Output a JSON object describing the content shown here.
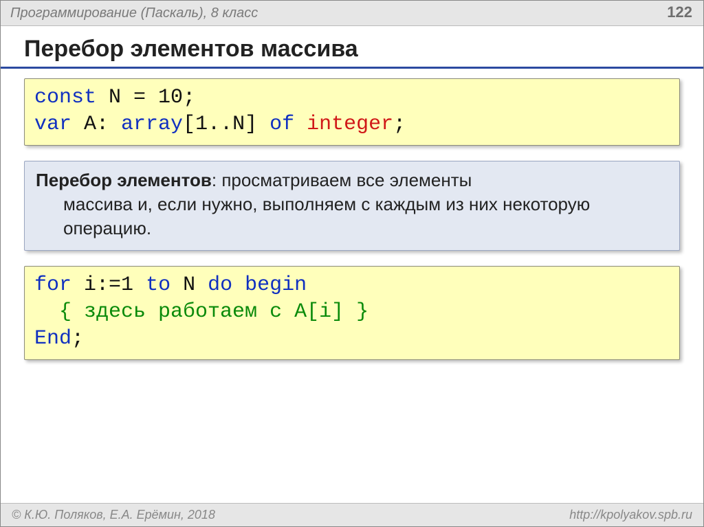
{
  "header": {
    "title": "Программирование (Паскаль), 8 класс",
    "page": "122"
  },
  "slide_title": "Перебор элементов массива",
  "code1": {
    "t1": "const",
    "t2": " N ",
    "eq": "=",
    "t3": " 10",
    "semi1": ";",
    "t4": "var",
    "t5": " A: ",
    "t6": "array",
    "t7": "[",
    "t8": "1",
    "t9": "..N] ",
    "t10": "of",
    "t11": " ",
    "t12": "integer",
    "semi2": ";"
  },
  "def": {
    "term": "Перебор элементов",
    "colon": ": ",
    "line1": "просматриваем все элементы",
    "line2": "массива и, если нужно, выполняем с каждым из них некоторую операцию."
  },
  "code2": {
    "t1": "for",
    "t2": " i:=",
    "t3": "1",
    "t4": " ",
    "t5": "to",
    "t6": " N ",
    "t7": "do",
    "t8": " ",
    "t9": "begin",
    "indent": "  ",
    "t10": "{ здесь работаем с A[i] }",
    "t11": "End",
    "semi": ";"
  },
  "footer": {
    "left": "© К.Ю. Поляков, Е.А. Ерёмин, 2018",
    "right": "http://kpolyakov.spb.ru"
  }
}
